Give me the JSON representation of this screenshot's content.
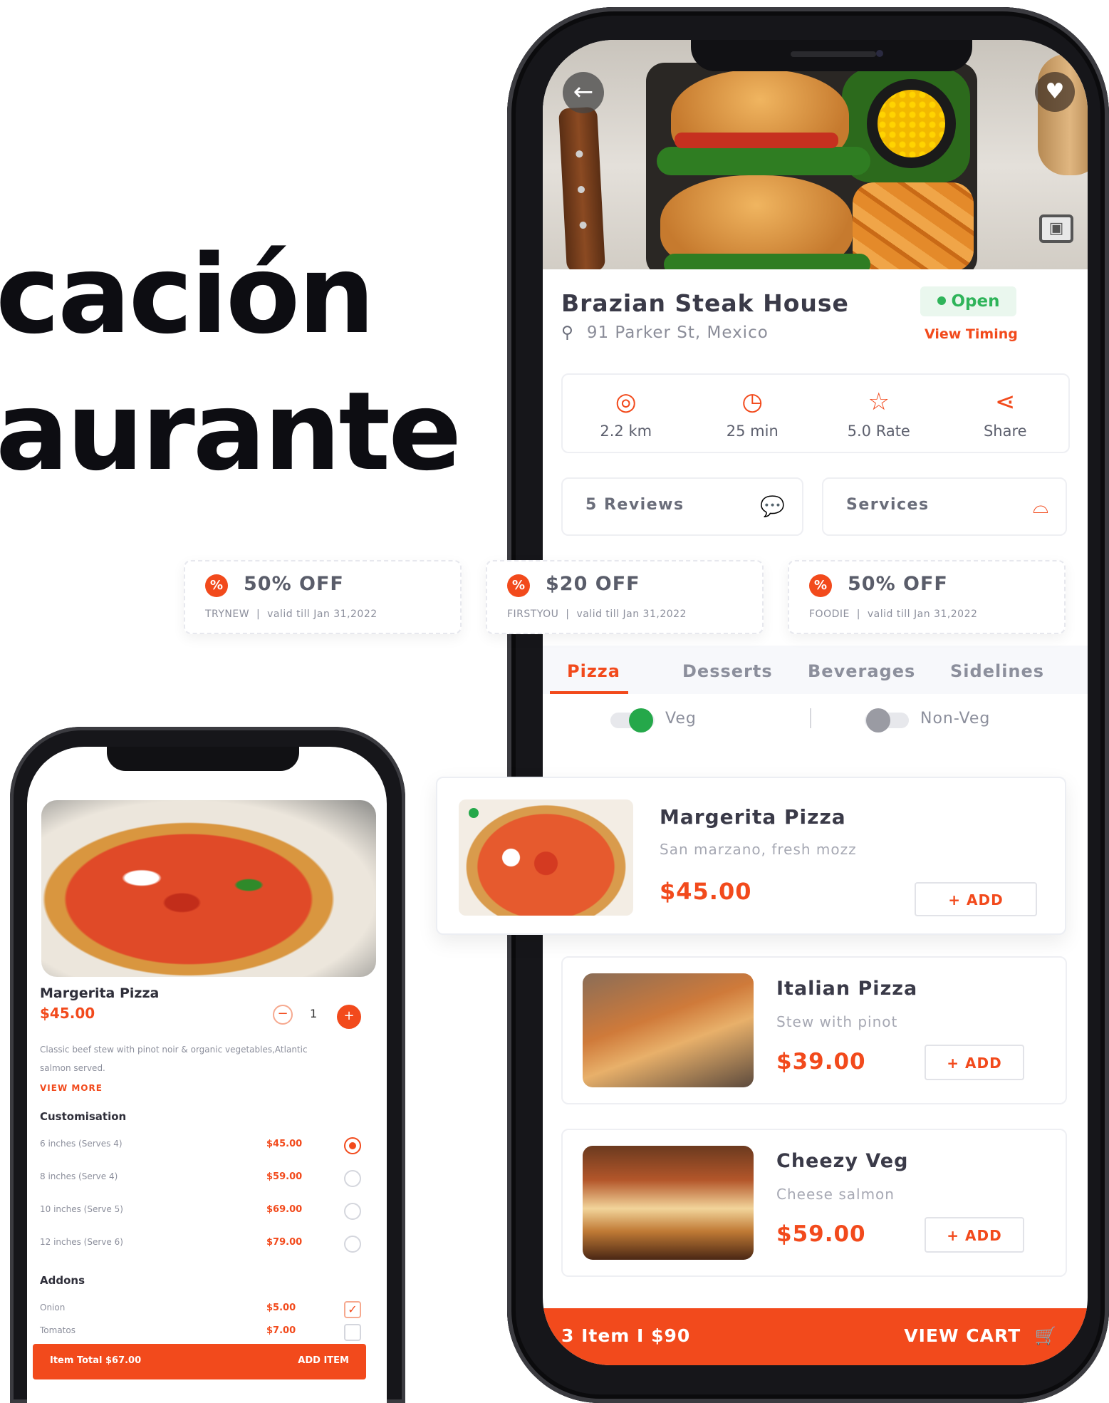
{
  "headline": {
    "line1": "cación",
    "line2": "aurante"
  },
  "restaurant": {
    "name": "Brazian Steak House",
    "address": "91 Parker St, Mexico",
    "status": "Open",
    "timing_link": "View Timing",
    "stats": [
      {
        "icon": "location-icon",
        "glyph": "◎",
        "label": "2.2 km"
      },
      {
        "icon": "clock-icon",
        "glyph": "◷",
        "label": "25 min"
      },
      {
        "icon": "star-icon",
        "glyph": "☆",
        "label": "5.0 Rate"
      },
      {
        "icon": "share-icon",
        "glyph": "⋖",
        "label": "Share"
      }
    ],
    "reviews_label": "5 Reviews",
    "services_label": "Services"
  },
  "coupons": [
    {
      "title": "50% OFF",
      "code": "TRYNEW",
      "validity": "valid till Jan 31,2022"
    },
    {
      "title": "$20 OFF",
      "code": "FIRSTYOU",
      "validity": "valid till Jan 31,2022"
    },
    {
      "title": "50% OFF",
      "code": "FOODIE",
      "validity": "valid till Jan 31,2022"
    }
  ],
  "tabs": [
    "Pizza",
    "Desserts",
    "Beverages",
    "Sidelines"
  ],
  "filters": {
    "veg": "Veg",
    "nonveg": "Non-Veg"
  },
  "items": [
    {
      "name": "Margerita Pizza",
      "desc": "San marzano, fresh mozz",
      "price": "$45.00",
      "add": "+ ADD"
    },
    {
      "name": "Italian Pizza",
      "desc": "Stew with pinot",
      "price": "$39.00",
      "add": "+ ADD"
    },
    {
      "name": "Cheezy Veg",
      "desc": "Cheese salmon",
      "price": "$59.00",
      "add": "+ ADD"
    }
  ],
  "cart": {
    "summary": "3 Item  I  $90",
    "action": "VIEW CART"
  },
  "detail": {
    "title": "Margerita Pizza",
    "price": "$45.00",
    "qty": "1",
    "desc": "Classic beef stew with pinot noir & organic vegetables,Atlantic salmon served.",
    "view_more": "VIEW MORE",
    "customisation_title": "Customisation",
    "sizes": [
      {
        "name": "6 inches (Serves 4)",
        "price": "$45.00",
        "selected": true
      },
      {
        "name": "8 inches (Serve 4)",
        "price": "$59.00",
        "selected": false
      },
      {
        "name": "10 inches (Serve 5)",
        "price": "$69.00",
        "selected": false
      },
      {
        "name": "12 inches (Serve 6)",
        "price": "$79.00",
        "selected": false
      }
    ],
    "addons_title": "Addons",
    "addons": [
      {
        "name": "Onion",
        "price": "$5.00",
        "checked": true
      },
      {
        "name": "Tomatos",
        "price": "$7.00",
        "checked": false
      }
    ],
    "total_label": "Item Total $67.00",
    "add_item": "ADD ITEM"
  },
  "colors": {
    "accent": "#f24a1c",
    "veg": "#25a84a",
    "open": "#2fb45a"
  }
}
